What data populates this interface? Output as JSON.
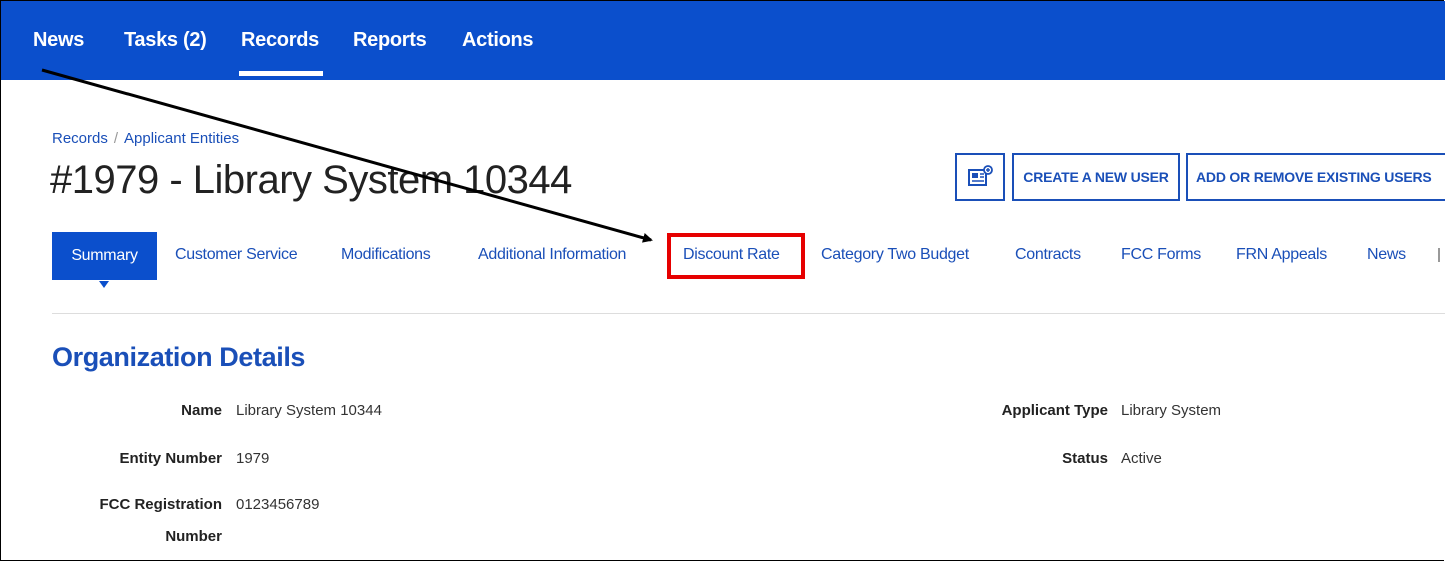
{
  "nav": {
    "items": [
      {
        "label": "News"
      },
      {
        "label": "Tasks (2)"
      },
      {
        "label": "Records"
      },
      {
        "label": "Reports"
      },
      {
        "label": "Actions"
      }
    ],
    "active": "Records"
  },
  "breadcrumb": {
    "items": [
      "Records",
      "Applicant Entities"
    ]
  },
  "page": {
    "title": "#1979 - Library System 10344"
  },
  "buttons": {
    "icon": "newspaper-plus-icon",
    "create_user": "CREATE A NEW USER",
    "add_remove_users": "ADD OR REMOVE EXISTING USERS"
  },
  "tabs": [
    {
      "label": "Summary"
    },
    {
      "label": "Customer Service"
    },
    {
      "label": "Modifications"
    },
    {
      "label": "Additional Information"
    },
    {
      "label": "Discount Rate"
    },
    {
      "label": "Category Two Budget"
    },
    {
      "label": "Contracts"
    },
    {
      "label": "FCC Forms"
    },
    {
      "label": "FRN Appeals"
    },
    {
      "label": "News"
    }
  ],
  "section": {
    "title": "Organization Details",
    "fields": {
      "name_label": "Name",
      "name_value": "Library System 10344",
      "entity_label": "Entity Number",
      "entity_value": "1979",
      "fcc_label_line1": "FCC Registration",
      "fcc_label_line2": "Number",
      "fcc_value": "0123456789",
      "type_label": "Applicant Type",
      "type_value": "Library System",
      "status_label": "Status",
      "status_value": "Active"
    }
  },
  "colors": {
    "primary": "#0b4fcc",
    "link": "#1a4fb8",
    "highlight": "#e60000"
  }
}
